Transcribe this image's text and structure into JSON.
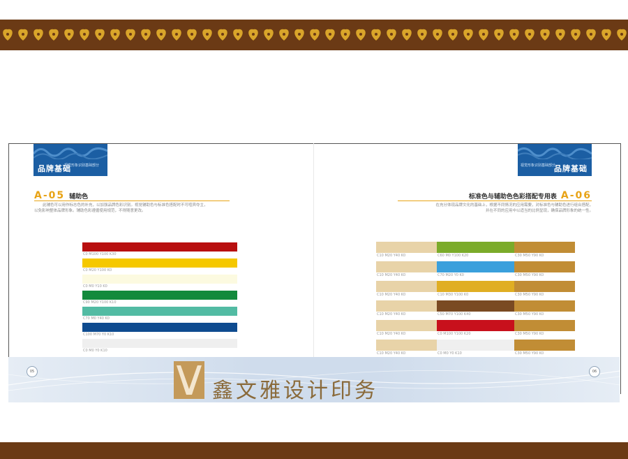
{
  "left_page": {
    "tag_title": "品牌基础",
    "tag_subtitle": "视觉形象识别基础部分",
    "section_code": "A-05",
    "section_name": "辅助色",
    "intro": [
      "此辅色可以用作标志色的补充，以加强品牌色彩识别。视觉辅助色与标准色搭配时不可喧宾夺主，",
      "以免影响整体品牌形象。辅助色彩遵循使用规范，不得随意更改。"
    ],
    "swatches": [
      {
        "color": "#b80f0f",
        "label": "C0 M100 Y100 K30"
      },
      {
        "color": "#f5c800",
        "label": "C0 M20 Y100 K0"
      },
      {
        "color": "#fcfae0",
        "label": "C0 M0 Y10 K0"
      },
      {
        "color": "#138a3c",
        "label": "C90 M20 Y100 K10"
      },
      {
        "color": "#52bba3",
        "label": "C70 M0 Y40 K0"
      },
      {
        "color": "#0e4b8f",
        "label": "C100 M70 Y0 K10"
      },
      {
        "color": "#efefef",
        "label": "C0 M0 Y0 K10"
      }
    ]
  },
  "right_page": {
    "tag_title": "品牌基础",
    "tag_subtitle": "视觉形象识别基础部分",
    "section_code": "A-06",
    "section_name": "标准色与辅助色色彩搭配专用表",
    "intro": [
      "在充分体现品牌文化的基础上，根据不同情况的应用需要，对标准色与辅助色进行组合搭配，",
      "并在不同的应用中以适当的比例呈现，确保品牌形象的统一性。"
    ],
    "rows": [
      [
        {
          "color": "#e8d3a8",
          "label": "C10 M20 Y40 K0"
        },
        {
          "color": "#7bab2a",
          "label": "C60 M0 Y100 K20"
        },
        {
          "color": "#c18d35",
          "label": "C30 M50 Y90 K0"
        }
      ],
      [
        {
          "color": "#e8d3a8",
          "label": "C10 M20 Y40 K0"
        },
        {
          "color": "#3aa0dc",
          "label": "C70 M20 Y0 K0"
        },
        {
          "color": "#c18d35",
          "label": "C30 M50 Y90 K0"
        }
      ],
      [
        {
          "color": "#e8d3a8",
          "label": "C10 M20 Y40 K0"
        },
        {
          "color": "#e0ae23",
          "label": "C10 M30 Y100 K0"
        },
        {
          "color": "#c18d35",
          "label": "C30 M50 Y90 K0"
        }
      ],
      [
        {
          "color": "#e8d3a8",
          "label": "C10 M20 Y40 K0"
        },
        {
          "color": "#7a4a22",
          "label": "C50 M70 Y100 K40"
        },
        {
          "color": "#c18d35",
          "label": "C30 M50 Y90 K0"
        }
      ],
      [
        {
          "color": "#e8d3a8",
          "label": "C10 M20 Y40 K0"
        },
        {
          "color": "#c8101c",
          "label": "C0 M100 Y100 K20"
        },
        {
          "color": "#c18d35",
          "label": "C30 M50 Y90 K0"
        }
      ],
      [
        {
          "color": "#e8d3a8",
          "label": "C10 M20 Y40 K0"
        },
        {
          "color": "#efefef",
          "label": "C0 M0 Y0 K10"
        },
        {
          "color": "#c18d35",
          "label": "C30 M50 Y90 K0"
        }
      ]
    ]
  },
  "footer": {
    "brand_name": "鑫文雅设计印务",
    "page_left": "05",
    "page_right": "06"
  },
  "colors": {
    "band": "#6b3a15",
    "ornament": "#d9a52a",
    "accent": "#e8a316",
    "tag_blue": "#1b5ea3"
  }
}
